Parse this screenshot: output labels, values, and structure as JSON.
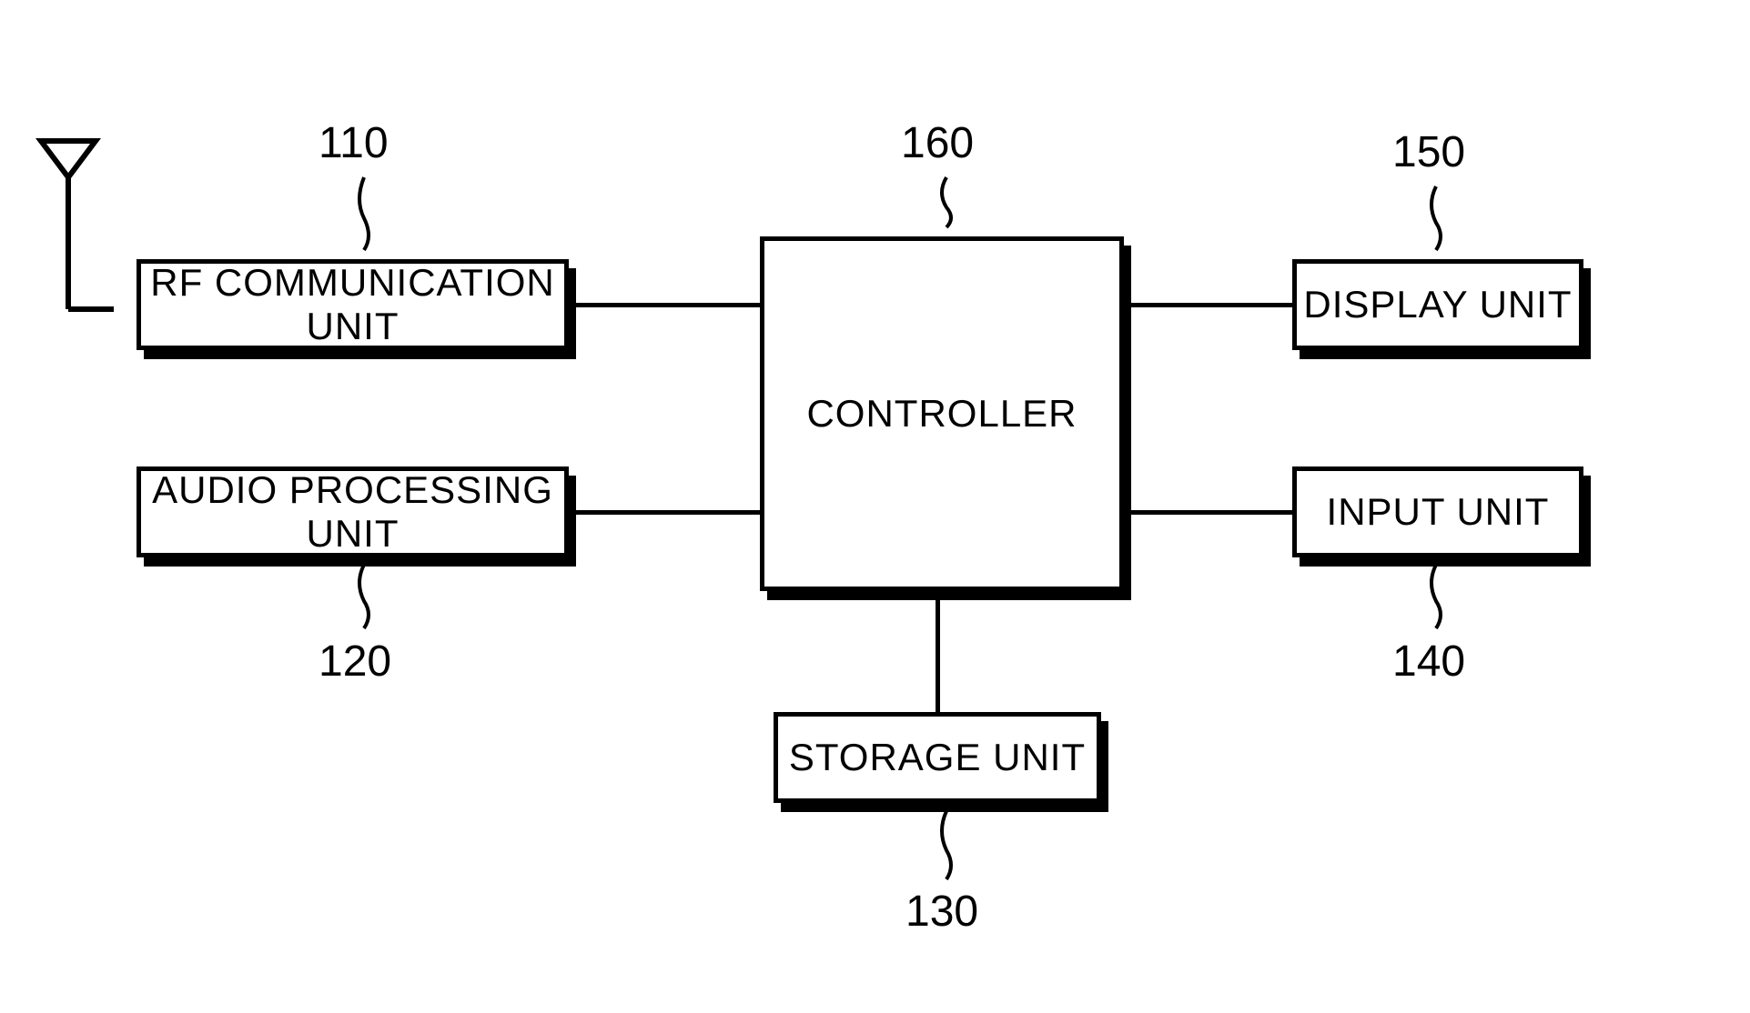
{
  "blocks": {
    "rf": {
      "label": "RF COMMUNICATION UNIT",
      "ref": "110"
    },
    "audio": {
      "label": "AUDIO PROCESSING UNIT",
      "ref": "120"
    },
    "storage": {
      "label": "STORAGE UNIT",
      "ref": "130"
    },
    "input": {
      "label": "INPUT UNIT",
      "ref": "140"
    },
    "display": {
      "label": "DISPLAY UNIT",
      "ref": "150"
    },
    "controller": {
      "label": "CONTROLLER",
      "ref": "160"
    }
  }
}
